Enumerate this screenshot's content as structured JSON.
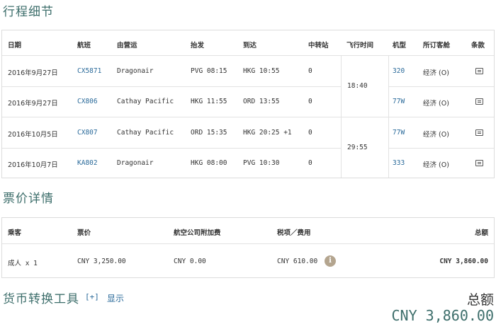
{
  "itinerary": {
    "title": "行程细节",
    "headers": {
      "date": "日期",
      "flight": "航班",
      "operated_by": "由营运",
      "depart": "抬发",
      "arrive": "到达",
      "stops": "中转站",
      "duration": "飞行时间",
      "aircraft": "机型",
      "cabin": "所订客舱",
      "terms": "条款"
    },
    "rows": [
      {
        "date": "2016年9月27日",
        "flight": "CX5871",
        "operated_by": "Dragonair",
        "depart": "PVG 08:15",
        "arrive": "HKG 10:55",
        "stops": "0",
        "aircraft": "320",
        "cabin": "经济 (O)"
      },
      {
        "date": "2016年9月27日",
        "flight": "CX806",
        "operated_by": "Cathay Pacific",
        "depart": "HKG 11:55",
        "arrive": "ORD 13:55",
        "stops": "0",
        "aircraft": "77W",
        "cabin": "经济 (O)"
      },
      {
        "date": "2016年10月5日",
        "flight": "CX807",
        "operated_by": "Cathay Pacific",
        "depart": "ORD 15:35",
        "arrive": "HKG 20:25 +1",
        "stops": "0",
        "aircraft": "77W",
        "cabin": "经济 (O)"
      },
      {
        "date": "2016年10月7日",
        "flight": "KA802",
        "operated_by": "Dragonair",
        "depart": "HKG 08:00",
        "arrive": "PVG 10:30",
        "stops": "0",
        "aircraft": "333",
        "cabin": "经济 (O)"
      }
    ],
    "durations": [
      "18:40",
      "29:55"
    ],
    "terms_icon": "document-icon"
  },
  "fare": {
    "title": "票价详情",
    "headers": {
      "passenger": "乘客",
      "fare": "票价",
      "surcharge": "航空公司附加费",
      "taxes": "税项／费用",
      "total": "总额"
    },
    "row": {
      "passenger": "成人 x 1",
      "fare": "CNY 3,250.00",
      "surcharge": "CNY 0.00",
      "taxes": "CNY 610.00",
      "total": "CNY 3,860.00"
    },
    "info_icon": "info-icon",
    "info_glyph": "i"
  },
  "currency": {
    "title": "货币转换工具",
    "toggle": "[+]",
    "show": "显示"
  },
  "grand_total": {
    "label": "总额",
    "value": "CNY 3,860.00"
  },
  "colors": {
    "accent": "#3d6e6b",
    "link": "#2a6a9a",
    "info_icon_bg": "#b4a58f"
  }
}
